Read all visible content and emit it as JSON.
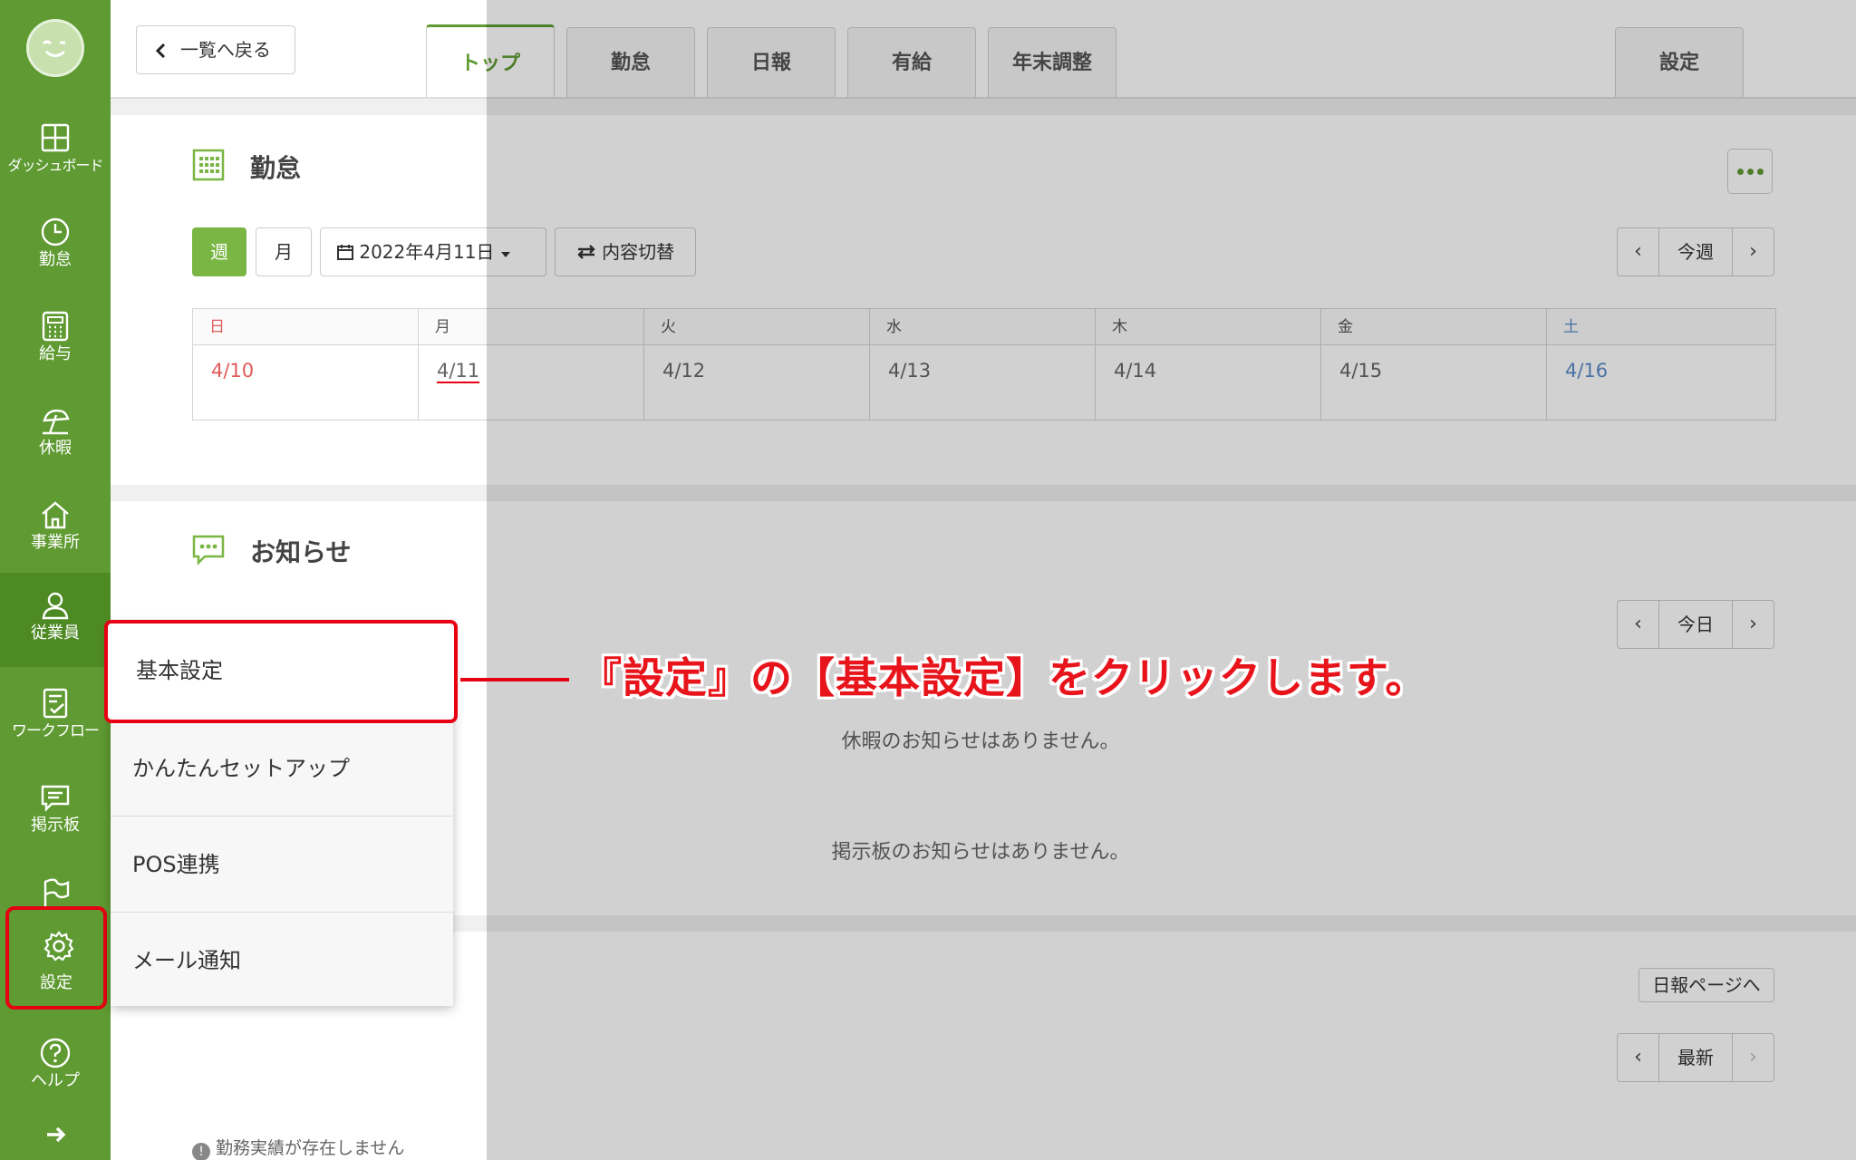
{
  "sidebar": {
    "items": [
      {
        "label": "ダッシュボード"
      },
      {
        "label": "勤怠"
      },
      {
        "label": "給与"
      },
      {
        "label": "休暇"
      },
      {
        "label": "事業所"
      },
      {
        "label": "従業員"
      },
      {
        "label": "ワークフロー"
      },
      {
        "label": "掲示板"
      },
      {
        "label": "設定"
      },
      {
        "label": "ヘルプ"
      }
    ]
  },
  "header": {
    "back_label": "一覧へ戻る",
    "tabs": [
      {
        "label": "トップ",
        "active": true
      },
      {
        "label": "勤怠"
      },
      {
        "label": "日報"
      },
      {
        "label": "有給"
      },
      {
        "label": "年末調整"
      },
      {
        "label": "設定"
      }
    ]
  },
  "attendance": {
    "title": "勤怠",
    "week_button": "週",
    "month_button": "月",
    "date_picker": "2022年4月11日",
    "switch_button": "内容切替",
    "pager_label": "今週",
    "calendar": [
      {
        "dow": "日",
        "date": "4/10"
      },
      {
        "dow": "月",
        "date": "4/11"
      },
      {
        "dow": "火",
        "date": "4/12"
      },
      {
        "dow": "水",
        "date": "4/13"
      },
      {
        "dow": "木",
        "date": "4/14"
      },
      {
        "dow": "金",
        "date": "4/15"
      },
      {
        "dow": "土",
        "date": "4/16"
      }
    ]
  },
  "notices": {
    "title": "お知らせ",
    "pager_label": "今日",
    "leave_empty": "休暇のお知らせはありません。",
    "board_empty": "掲示板のお知らせはありません。"
  },
  "daily_report": {
    "link_label": "日報ページへ",
    "pager_label": "最新",
    "no_record": "勤務実績が存在しません"
  },
  "settings_menu": {
    "items": [
      {
        "label": "基本設定"
      },
      {
        "label": "かんたんセットアップ"
      },
      {
        "label": "POS連携"
      },
      {
        "label": "メール通知"
      }
    ]
  },
  "annotation": {
    "text": "『設定』の【基本設定】をクリックします。"
  },
  "colors": {
    "sidebar": "#5f9a32",
    "accent": "#7ab644",
    "highlight": "#e60012"
  }
}
